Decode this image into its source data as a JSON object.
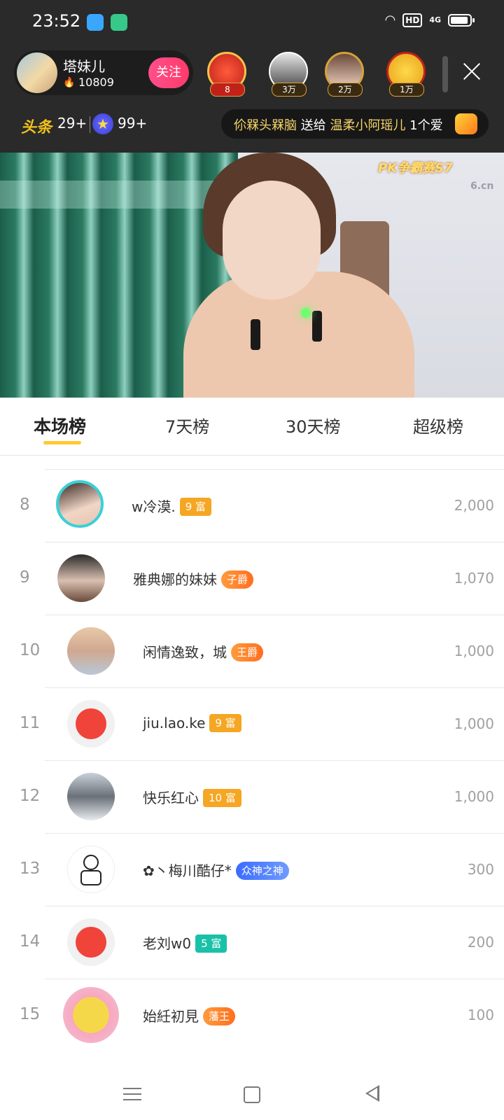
{
  "status": {
    "time": "23:52",
    "hd": "HD",
    "network": "4G"
  },
  "host": {
    "name": "塔妹儿",
    "heat": "10809",
    "follow_label": "关注"
  },
  "viewers": [
    {
      "badge": "8"
    },
    {
      "badge": "3万"
    },
    {
      "badge": "2万"
    },
    {
      "badge": "1万"
    }
  ],
  "stats": {
    "toutiao_label": "头条",
    "toutiao_count": "29+",
    "star_count": "99+"
  },
  "gift_message": {
    "sender": "伱槑头槑脑",
    "verb": " 送给 ",
    "receiver": "温柔小阿瑶儿",
    "gift": " 1个爱"
  },
  "video": {
    "pk_logo": "PK争霸赛S7",
    "watermark": "6.cn"
  },
  "tabs": [
    {
      "label": "本场榜",
      "active": true
    },
    {
      "label": "7天榜"
    },
    {
      "label": "30天榜"
    },
    {
      "label": "超级榜"
    }
  ],
  "ranking": [
    {
      "rank": "8",
      "name": "w冷漠.",
      "tag": "9 富",
      "amount": "2,000"
    },
    {
      "rank": "9",
      "name": "雅典娜的妹妹",
      "tag": "子爵",
      "amount": "1,070"
    },
    {
      "rank": "10",
      "name": "闲情逸致，城",
      "tag": "王爵",
      "amount": "1,000"
    },
    {
      "rank": "11",
      "name": "jiu.lao.ke",
      "tag": "9 富",
      "amount": "1,000"
    },
    {
      "rank": "12",
      "name": "快乐红心",
      "tag": "10 富",
      "amount": "1,000"
    },
    {
      "rank": "13",
      "name": "✿丶梅川酷仔*",
      "tag": "众神之神",
      "amount": "300"
    },
    {
      "rank": "14",
      "name": "老刘w0",
      "tag": "5 富",
      "amount": "200"
    },
    {
      "rank": "15",
      "name": "始紝初見",
      "tag": "藩王",
      "amount": "100"
    }
  ],
  "colors": {
    "accent": "#ffc933",
    "follow": "#ff4f8b",
    "gift_highlight": "#f5d46a"
  }
}
